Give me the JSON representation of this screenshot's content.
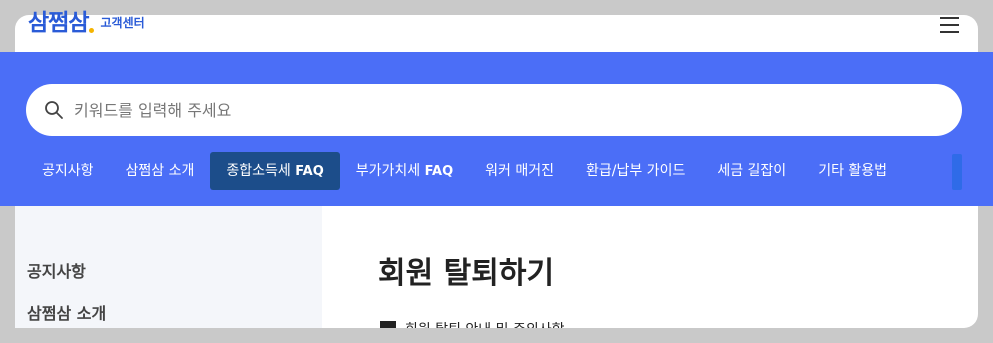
{
  "header": {
    "logo_text": "삼쩜삼",
    "logo_sub": "고객센터",
    "menu_icon": "hamburger-menu-icon"
  },
  "search": {
    "placeholder": "키워드를 입력해 주세요",
    "icon": "search-icon"
  },
  "tabs": [
    {
      "label": "공지사항",
      "suffix": ""
    },
    {
      "label": "삼쩜삼 소개",
      "suffix": ""
    },
    {
      "label": "종합소득세 ",
      "suffix": "FAQ"
    },
    {
      "label": "부가가치세 ",
      "suffix": "FAQ"
    },
    {
      "label": "워커 매거진",
      "suffix": ""
    },
    {
      "label": "환급/납부 가이드",
      "suffix": ""
    },
    {
      "label": "세금 길잡이",
      "suffix": ""
    },
    {
      "label": "기타 활용법",
      "suffix": ""
    }
  ],
  "active_tab": 2,
  "sidebar": {
    "items": [
      "공지사항",
      "삼쩜삼 소개"
    ]
  },
  "article": {
    "title": "회원 탈퇴하기",
    "section_heading": "회원 탈퇴 안내 및 주의사항"
  },
  "colors": {
    "brand_blue": "#4b6ef7",
    "active_tab": "#1c4d8a",
    "logo": "#2a5bd7"
  }
}
